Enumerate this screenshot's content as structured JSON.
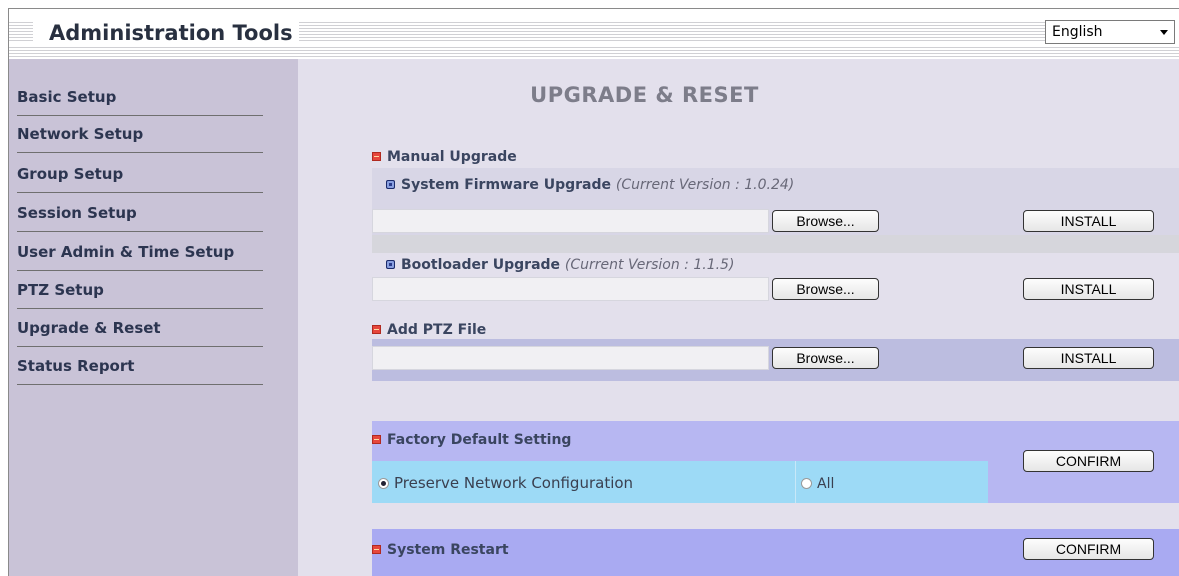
{
  "header": {
    "title": "Administration Tools",
    "language": "English"
  },
  "sidebar": {
    "items": [
      {
        "label": "Basic Setup"
      },
      {
        "label": "Network Setup"
      },
      {
        "label": "Group Setup"
      },
      {
        "label": "Session Setup"
      },
      {
        "label": "User Admin & Time Setup"
      },
      {
        "label": "PTZ Setup"
      },
      {
        "label": "Upgrade & Reset"
      },
      {
        "label": "Status Report"
      }
    ]
  },
  "main": {
    "title": "UPGRADE & RESET",
    "manual_upgrade": {
      "label": "Manual Upgrade",
      "firmware": {
        "label": "System Firmware Upgrade",
        "version": "(Current Version : 1.0.24)",
        "browse": "Browse...",
        "install": "INSTALL"
      },
      "bootloader": {
        "label": "Bootloader Upgrade",
        "version": "(Current Version : 1.1.5)",
        "browse": "Browse...",
        "install": "INSTALL"
      }
    },
    "ptz_file": {
      "label": "Add PTZ File",
      "browse": "Browse...",
      "install": "INSTALL"
    },
    "factory_default": {
      "label": "Factory Default Setting",
      "option_preserve": "Preserve Network Configuration",
      "option_all": "All",
      "selected": "Preserve Network Configuration",
      "confirm": "CONFIRM"
    },
    "restart": {
      "label": "System Restart",
      "confirm": "CONFIRM"
    }
  },
  "colors": {
    "sidebar_bg": "#c9c3d7",
    "main_bg": "#e3e0ec",
    "row_firmware": "#d8d6e6",
    "row_ptz": "#bcbde0",
    "row_factory": "#b7b7f2",
    "row_factory_options": "#9ddaf6",
    "row_restart": "#a9aaf2",
    "section_icon_red": "#e6463c",
    "section_icon_blue": "#2a3c8c"
  }
}
